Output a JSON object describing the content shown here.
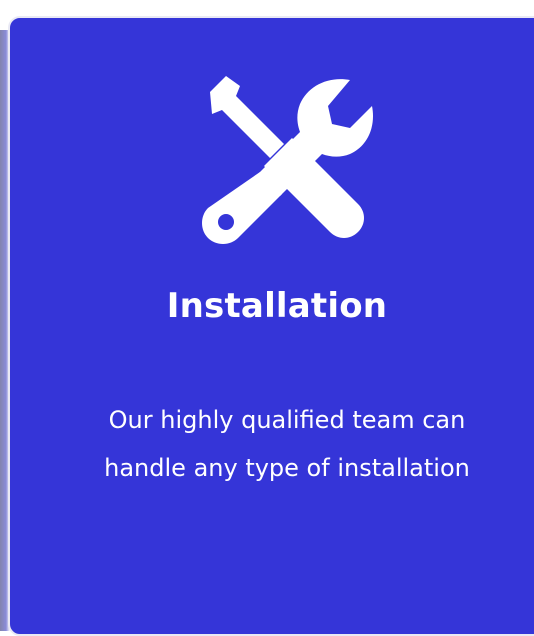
{
  "card": {
    "icon": "tools-icon",
    "title": "Installation",
    "description_lines": [
      "Our highly qualified team can",
      "handle any type of installation"
    ],
    "colors": {
      "background": "#3535d8",
      "text": "#ffffff",
      "border": "#e9e9f4"
    }
  }
}
